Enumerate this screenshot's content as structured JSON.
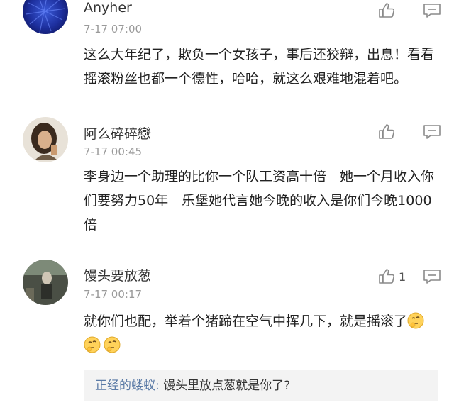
{
  "comments": [
    {
      "author": "Anyher",
      "time": "7-17 07:00",
      "text": "这么大年纪了，欺负一个女孩子，事后还狡辩，出息！看看摇滚粉丝也都一个德性，哈哈，就这么艰难地混着吧。",
      "like_count": ""
    },
    {
      "author": "阿么碎碎戀",
      "time": "7-17 00:45",
      "text": "李身边一个助理的比你一个队工资高十倍　她一个月收入你们要努力50年　乐堡她代言她今晚的收入是你们今晚1000倍",
      "like_count": ""
    },
    {
      "author": "馒头要放葱",
      "time": "7-17 00:17",
      "text": "就你们也配，举着个猪蹄在空气中挥几下，就是摇滚了",
      "like_count": "1",
      "emojis": [
        "thinking-face",
        "thinking-face",
        "thinking-face"
      ],
      "reply": {
        "author": "正经的蝼蚁:",
        "text": " 馒头里放点葱就是你了?"
      }
    }
  ],
  "icons": {
    "like": "thumbs-up-icon",
    "reply": "comment-bubble-icon"
  },
  "colors": {
    "reply_author": "#5a7aa6",
    "time": "#9a9a9a",
    "reply_bg": "#f3f3f3"
  }
}
